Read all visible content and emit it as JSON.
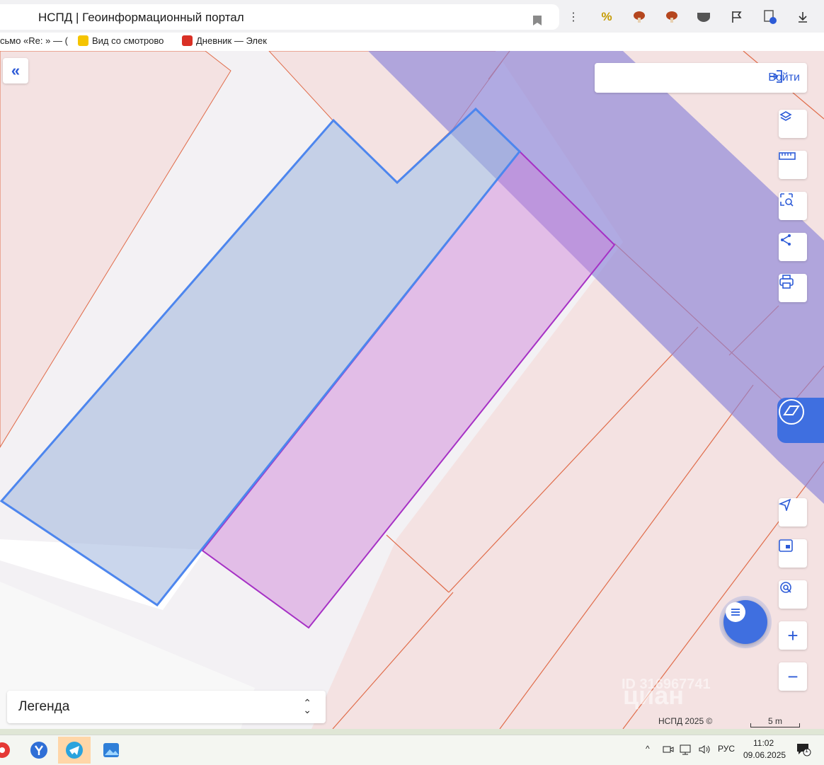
{
  "browser": {
    "title": "НСПД | Геоинформационный портал",
    "bookmarks": [
      {
        "label": "сьмо «Re: » — (",
        "color": "#ffffff"
      },
      {
        "label": "Вид со смотрово",
        "color": "#f5c400"
      },
      {
        "label": "Дневник — Элек",
        "color": "#d93025"
      }
    ],
    "extensions": [
      "percent-icon",
      "mushroom-icon",
      "mushroom-alt-icon",
      "shield-icon",
      "map-flag-icon",
      "secure-shield-icon",
      "download-icon"
    ]
  },
  "map": {
    "login_label": "Войти",
    "legend_label": "Легенда",
    "copyright": "НСПД 2025 ©",
    "scale": "5 m",
    "watermark": "циан",
    "watermark_id": "ID 316967741",
    "colors": {
      "selected_parcel": "#4d86ee",
      "adjacent_parcel": "#a631c5",
      "zone_overlay": "#8c84d8",
      "parcel_border": "#e06c4a",
      "accent": "#3f6fe0"
    },
    "tools": [
      "layers-icon",
      "ruler-icon",
      "select-area-icon",
      "share-icon",
      "print-icon"
    ],
    "nav_tools": [
      "locate-icon",
      "minimap-icon",
      "search-map-icon",
      "zoom-in-icon",
      "zoom-out-icon"
    ]
  },
  "taskbar": {
    "apps": [
      "pinned-app-icon",
      "yandex-browser-icon",
      "telegram-icon",
      "photos-icon"
    ],
    "language": "РУС",
    "time": "11:02",
    "date": "09.06.2025",
    "notification_count": "1"
  }
}
